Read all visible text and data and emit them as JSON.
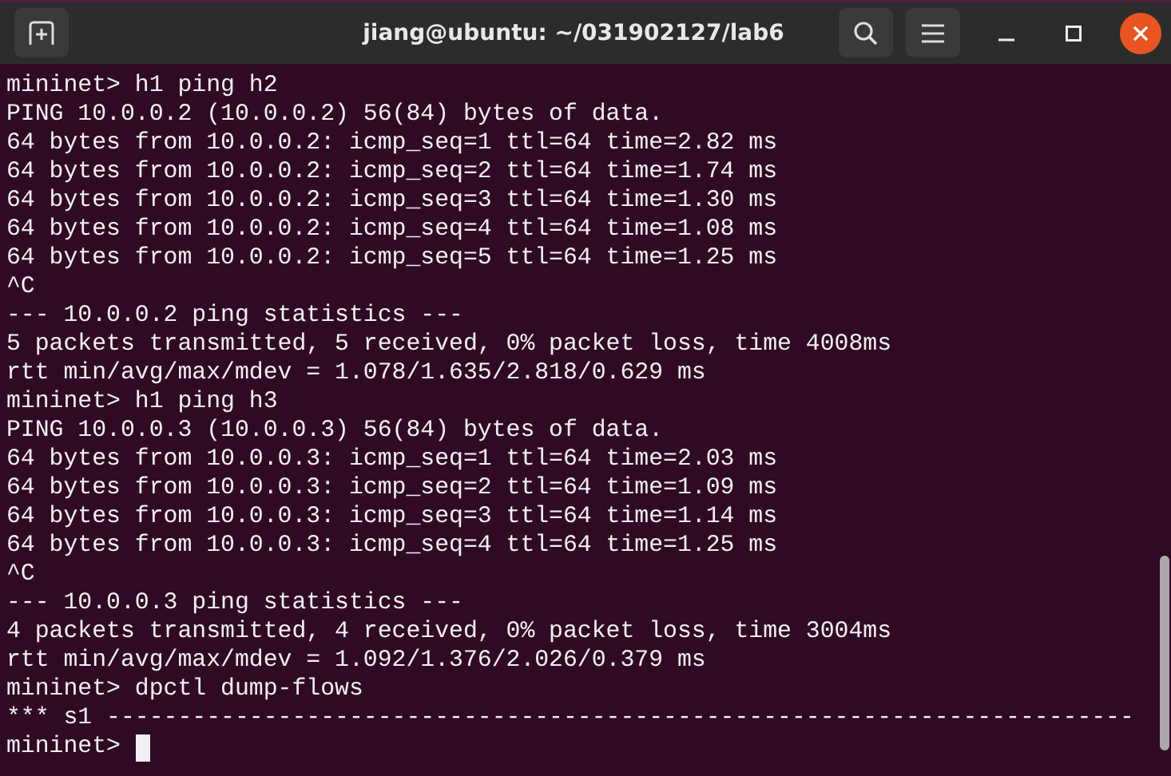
{
  "window": {
    "title": "jiang@ubuntu: ~/031902127/lab6"
  },
  "lines": [
    "mininet> h1 ping h2",
    "PING 10.0.0.2 (10.0.0.2) 56(84) bytes of data.",
    "64 bytes from 10.0.0.2: icmp_seq=1 ttl=64 time=2.82 ms",
    "64 bytes from 10.0.0.2: icmp_seq=2 ttl=64 time=1.74 ms",
    "64 bytes from 10.0.0.2: icmp_seq=3 ttl=64 time=1.30 ms",
    "64 bytes from 10.0.0.2: icmp_seq=4 ttl=64 time=1.08 ms",
    "64 bytes from 10.0.0.2: icmp_seq=5 ttl=64 time=1.25 ms",
    "^C",
    "--- 10.0.0.2 ping statistics ---",
    "5 packets transmitted, 5 received, 0% packet loss, time 4008ms",
    "rtt min/avg/max/mdev = 1.078/1.635/2.818/0.629 ms",
    "mininet> h1 ping h3",
    "PING 10.0.0.3 (10.0.0.3) 56(84) bytes of data.",
    "64 bytes from 10.0.0.3: icmp_seq=1 ttl=64 time=2.03 ms",
    "64 bytes from 10.0.0.3: icmp_seq=2 ttl=64 time=1.09 ms",
    "64 bytes from 10.0.0.3: icmp_seq=3 ttl=64 time=1.14 ms",
    "64 bytes from 10.0.0.3: icmp_seq=4 ttl=64 time=1.25 ms",
    "^C",
    "--- 10.0.0.3 ping statistics ---",
    "4 packets transmitted, 4 received, 0% packet loss, time 3004ms",
    "rtt min/avg/max/mdev = 1.092/1.376/2.026/0.379 ms",
    "mininet> dpctl dump-flows",
    "*** s1 ------------------------------------------------------------------------"
  ],
  "prompt": "mininet>"
}
